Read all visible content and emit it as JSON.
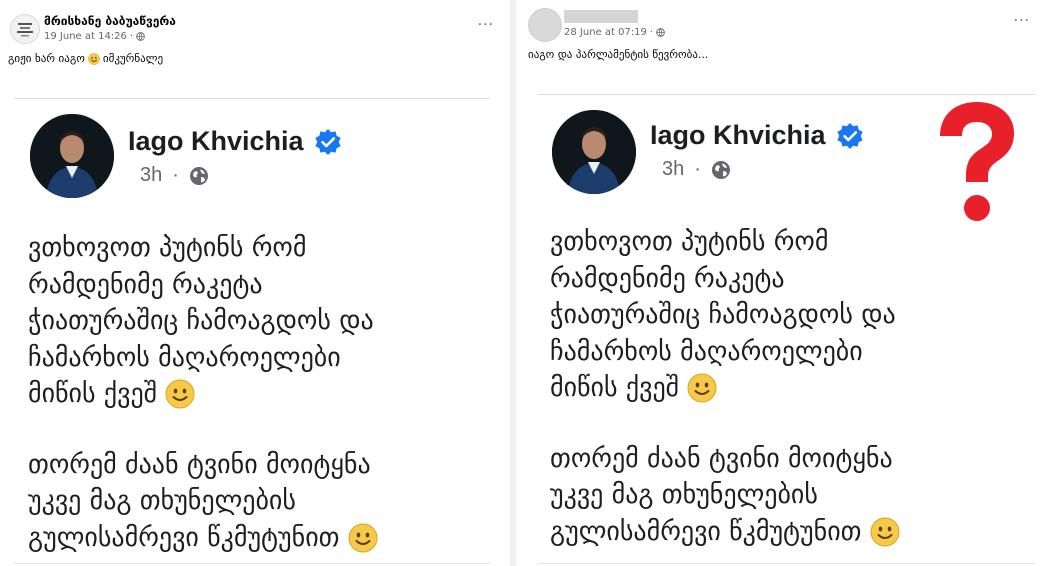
{
  "posts": [
    {
      "author": "მრისხანე ბაბუაწვერა",
      "date": "19 June at 14:26",
      "dot": "·",
      "more": "···",
      "caption": "გიჟი ხარ იაგო",
      "caption_suffix": "იმკურნალე",
      "screenshot": {
        "name": "Iago Khvichia",
        "time": "3h",
        "time_dot": "·",
        "lines": [
          "ვთხოვოთ პუტინს რომ",
          "რამდენიმე რაკეტა",
          "ჭიათურაშიც ჩამოაგდოს და",
          "ჩამარხოს მაღაროელები",
          "მიწის ქვეშ",
          "თორემ ძაან ტვინი მოიტყნა",
          "უკვე მაგ თხუნელების",
          "გულისამრევი წკმუტუნით"
        ]
      }
    },
    {
      "author": "",
      "date": "28 June at 07:19",
      "dot": "·",
      "more": "···",
      "caption": "იაგო და პარლამენტის წევრობა...",
      "screenshot": {
        "name": "Iago Khvichia",
        "time": "3h",
        "time_dot": "·",
        "lines": [
          "ვთხოვოთ პუტინს რომ",
          "რამდენიმე რაკეტა",
          "ჭიათურაშიც ჩამოაგდოს და",
          "ჩამარხოს მაღაროელები",
          "მიწის ქვეშ",
          "თორემ ძაან ტვინი მოიტყნა",
          "უკვე მაგ თხუნელების",
          "გულისამრევი წკმუტუნით"
        ]
      }
    }
  ],
  "colors": {
    "verified": "#1877f2",
    "question_mark": "#e8202a",
    "emoji": "#f7c948"
  },
  "icons": [
    "globe-icon",
    "more-options-icon",
    "verified-badge-icon",
    "smiley-emoji-icon",
    "question-mark-icon"
  ]
}
